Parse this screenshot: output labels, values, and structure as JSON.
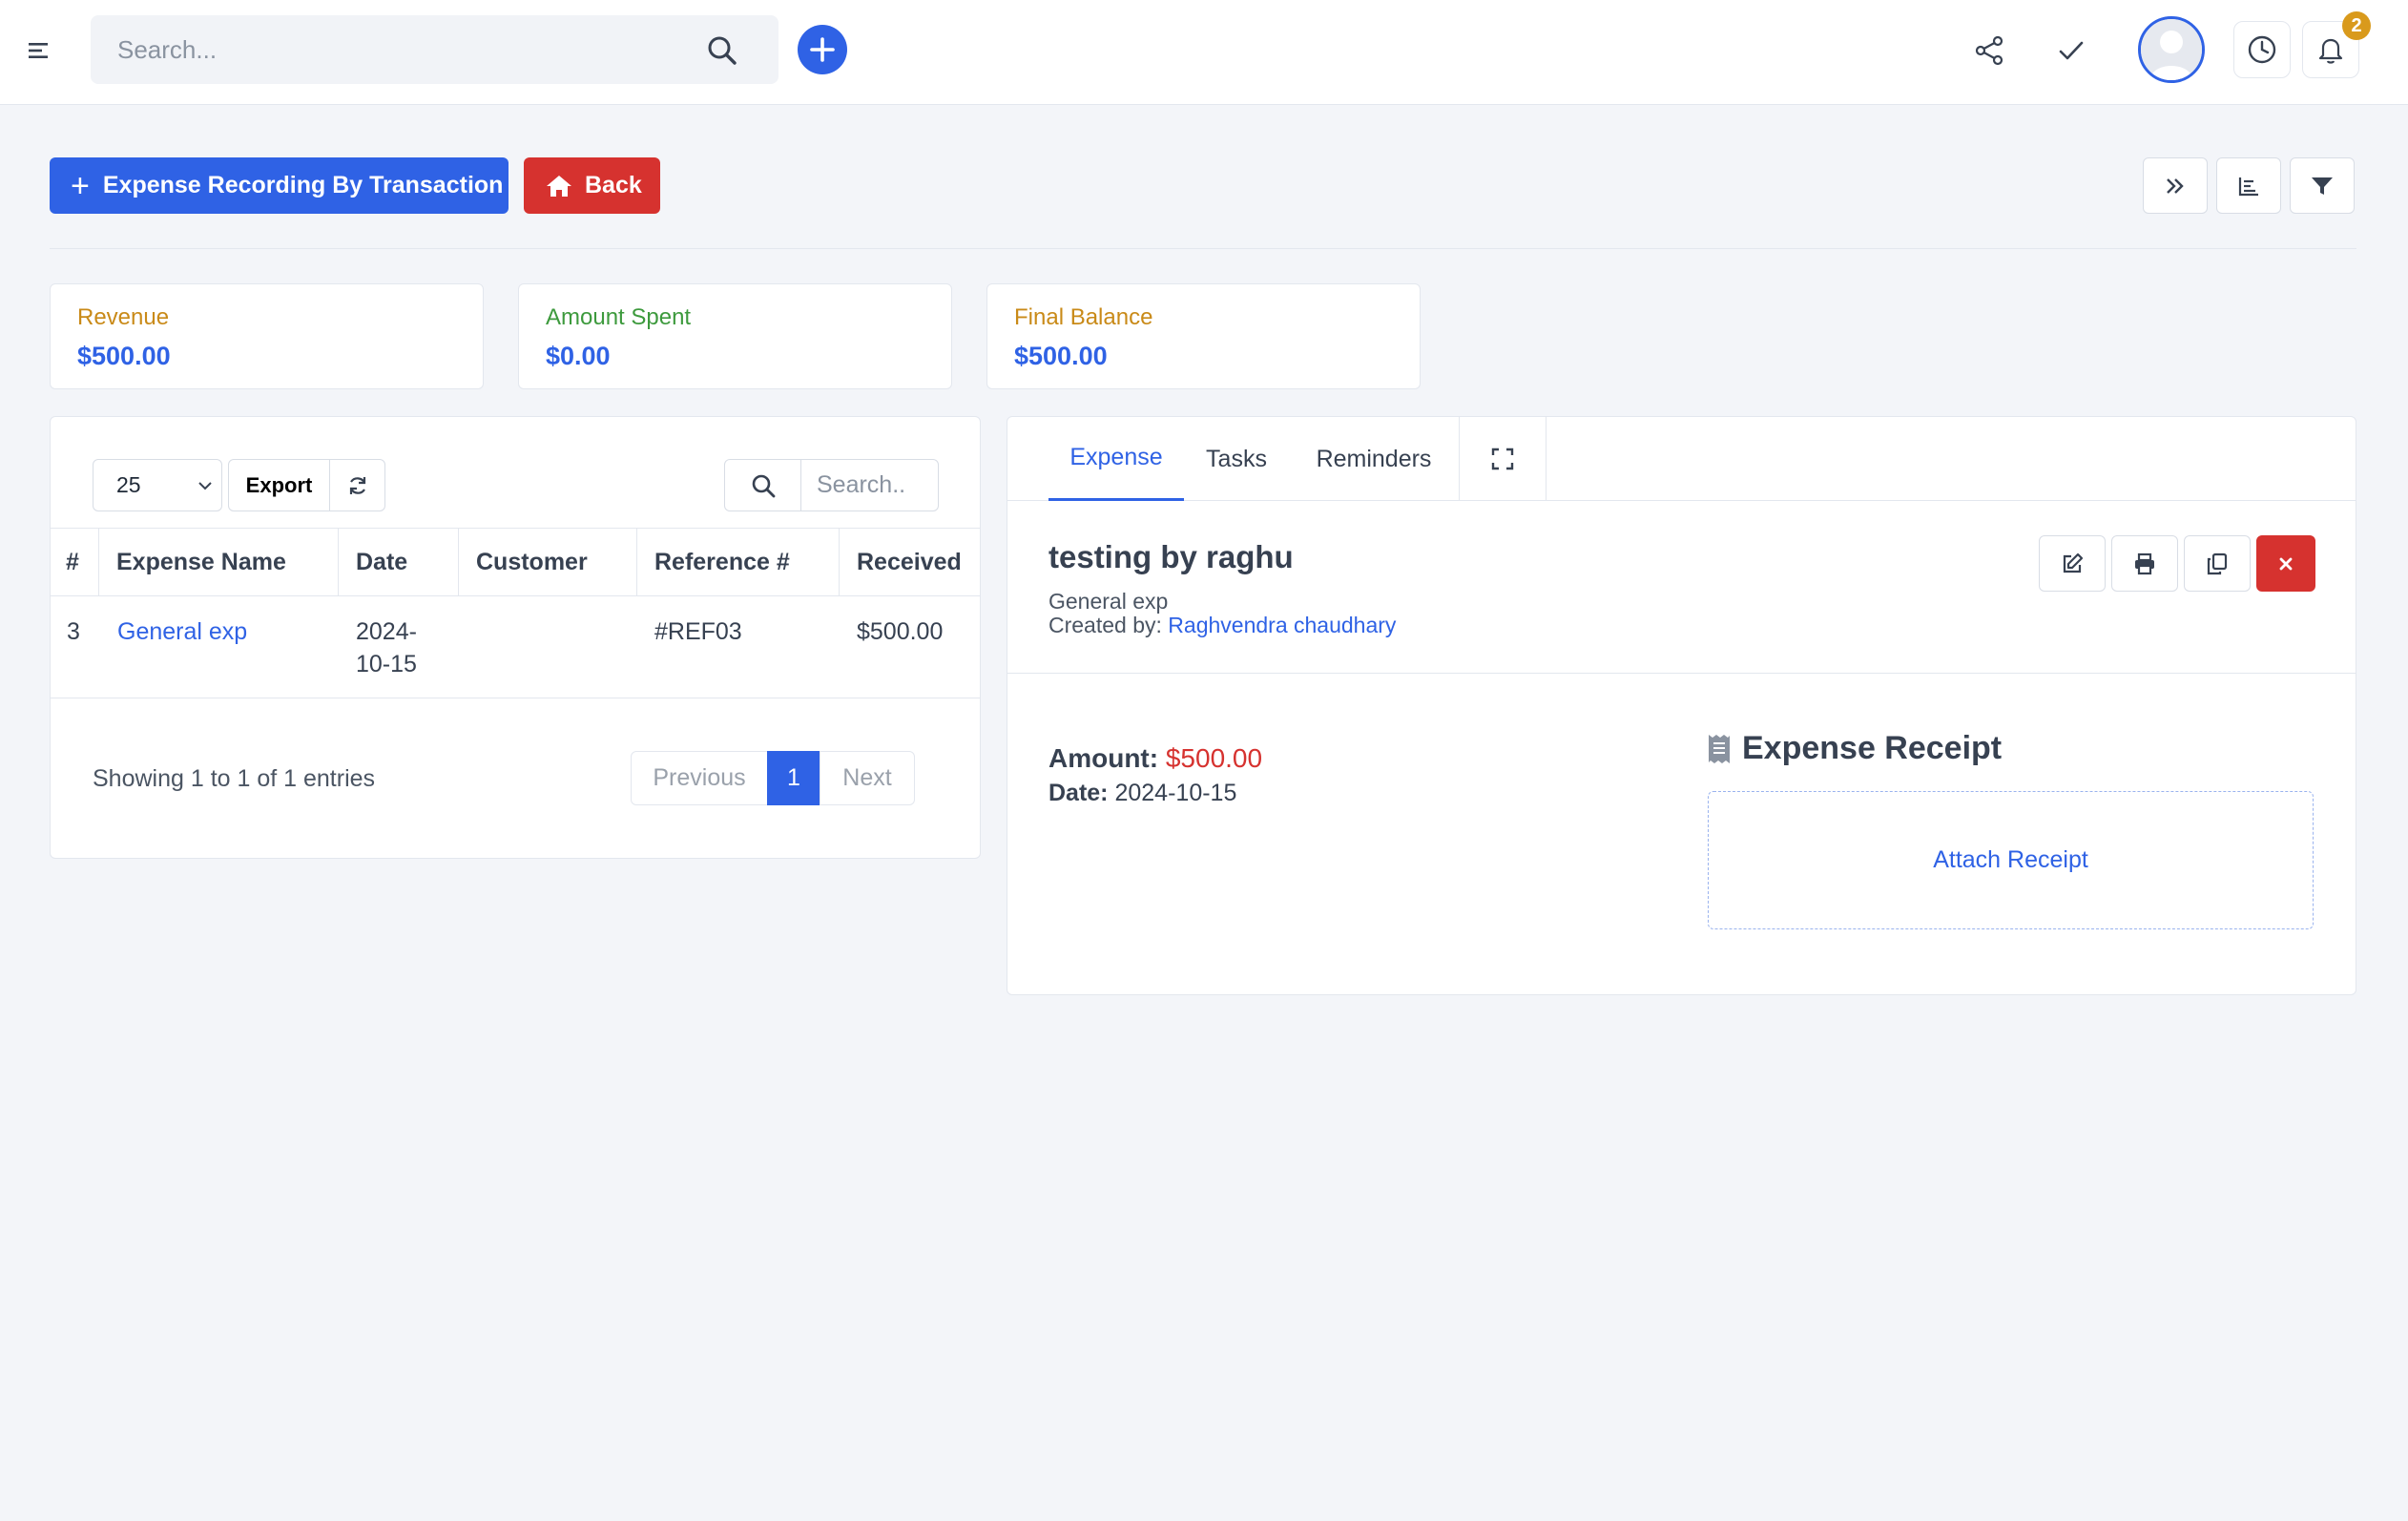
{
  "topbar": {
    "search_placeholder": "Search...",
    "notification_count": "2",
    "icons": [
      "menu-icon",
      "search-icon",
      "plus-icon",
      "share-icon",
      "check-icon",
      "avatar-icon",
      "clock-icon",
      "bell-icon"
    ]
  },
  "toolbar": {
    "add_label": "Expense Recording By Transaction",
    "back_label": "Back"
  },
  "stats": [
    {
      "label": "Revenue",
      "value": "$500.00",
      "label_color": "#c98a18"
    },
    {
      "label": "Amount Spent",
      "value": "$0.00",
      "label_color": "#3d9a3d"
    },
    {
      "label": "Final Balance",
      "value": "$500.00",
      "label_color": "#c98a18"
    }
  ],
  "table": {
    "page_size": "25",
    "export_label": "Export",
    "search_placeholder": "Search..",
    "columns": [
      "#",
      "Expense Name",
      "Date",
      "Customer",
      "Reference #",
      "Received"
    ],
    "rows": [
      {
        "id": "3",
        "name": "General exp",
        "date_line1": "2024-",
        "date_line2": "10-15",
        "customer": "",
        "reference": "#REF03",
        "received": "$500.00"
      }
    ],
    "info": "Showing 1 to 1 of 1 entries",
    "pager": {
      "prev": "Previous",
      "current": "1",
      "next": "Next"
    }
  },
  "detail": {
    "tabs": [
      "Expense",
      "Tasks",
      "Reminders"
    ],
    "title": "testing by raghu",
    "subtitle": "General exp",
    "created_label": "Created by:",
    "created_by": "Raghvendra chaudhary",
    "amount_label": "Amount:",
    "amount": "$500.00",
    "date_label": "Date:",
    "date": "2024-10-15",
    "receipt_title": "Expense Receipt",
    "attach_label": "Attach Receipt"
  },
  "colors": {
    "primary": "#2f62e5",
    "danger": "#d6322f",
    "warning": "#c98a18",
    "success": "#3d9a3d"
  }
}
